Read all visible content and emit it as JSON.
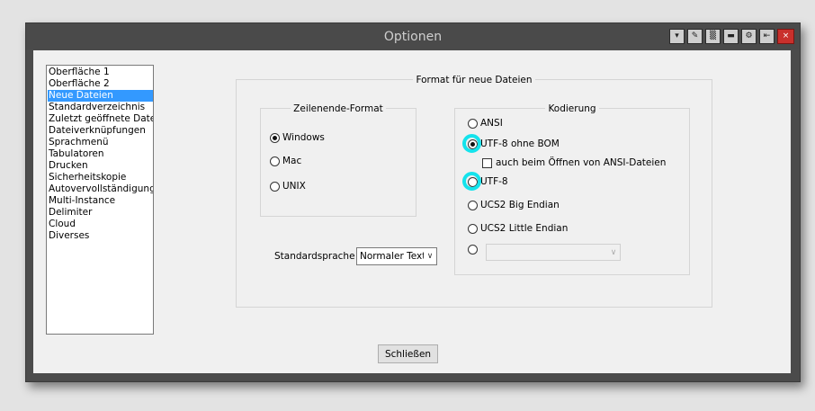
{
  "window": {
    "title": "Optionen",
    "titlebar_buttons": [
      {
        "name": "pin-icon",
        "glyph": "▾"
      },
      {
        "name": "pin2-icon",
        "glyph": "✎"
      },
      {
        "name": "transparency-icon",
        "glyph": "▒"
      },
      {
        "name": "minimize-icon",
        "glyph": "▬"
      },
      {
        "name": "settings-icon",
        "glyph": "⚙"
      },
      {
        "name": "restore-icon",
        "glyph": "⇤"
      }
    ],
    "close_glyph": "×",
    "accent_color": "#14e3ec",
    "selection_color": "#3399ff"
  },
  "sidebar": {
    "items": [
      {
        "label": "Oberfläche 1"
      },
      {
        "label": "Oberfläche 2"
      },
      {
        "label": "Neue Dateien",
        "selected": true
      },
      {
        "label": "Standardverzeichnis"
      },
      {
        "label": "Zuletzt geöffnete Dateien"
      },
      {
        "label": "Dateiverknüpfungen"
      },
      {
        "label": "Sprachmenü"
      },
      {
        "label": "Tabulatoren"
      },
      {
        "label": "Drucken"
      },
      {
        "label": "Sicherheitskopie"
      },
      {
        "label": "Autovervollständigung"
      },
      {
        "label": "Multi-Instance"
      },
      {
        "label": "Delimiter"
      },
      {
        "label": "Cloud"
      },
      {
        "label": "Diverses"
      }
    ]
  },
  "main": {
    "group_title": "Format für neue Dateien",
    "eol": {
      "title": "Zeilenende-Format",
      "options": [
        {
          "label": "Windows",
          "checked": true
        },
        {
          "label": "Mac",
          "checked": false
        },
        {
          "label": "UNIX",
          "checked": false
        }
      ]
    },
    "encoding": {
      "title": "Kodierung",
      "options": [
        {
          "label": "ANSI",
          "checked": false
        },
        {
          "label": "UTF-8 ohne BOM",
          "checked": true
        },
        {
          "label": "UTF-8",
          "checked": false
        },
        {
          "label": "UCS2 Big Endian",
          "checked": false
        },
        {
          "label": "UCS2 Little Endian",
          "checked": false
        },
        {
          "label": "",
          "checked": false
        }
      ],
      "checkbox_label": "auch beim Öffnen von ANSI-Dateien",
      "checkbox_checked": false,
      "codepage_value": ""
    },
    "default_language": {
      "label": "Standardsprache",
      "value": "Normaler Text"
    }
  },
  "footer": {
    "close_label": "Schließen"
  }
}
